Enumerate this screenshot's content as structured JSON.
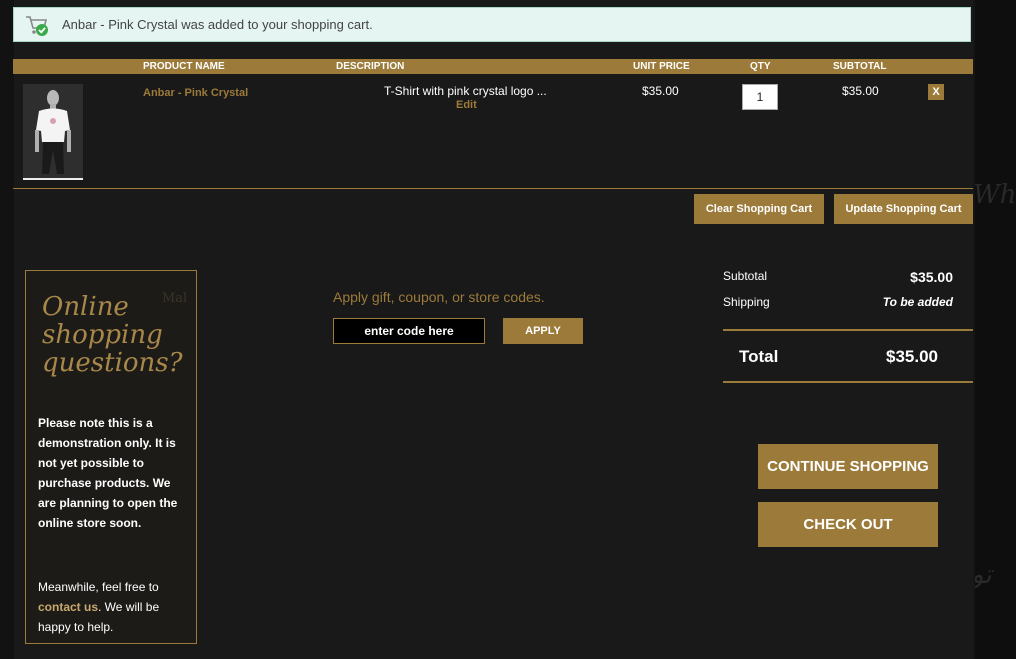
{
  "notice": {
    "message": "Anbar - Pink Crystal was added to your shopping cart.",
    "icon": "cart-check-icon"
  },
  "table": {
    "headers": {
      "product_name": "PRODUCT NAME",
      "description": "DESCRIPTION",
      "unit_price": "UNIT PRICE",
      "qty": "QTY",
      "subtotal": "SUBTOTAL"
    },
    "items": [
      {
        "name": "Anbar - Pink Crystal",
        "description": "T-Shirt with pink crystal logo ...",
        "edit_label": "Edit",
        "unit_price": "$35.00",
        "qty": "1",
        "subtotal": "$35.00",
        "remove_label": "X"
      }
    ]
  },
  "cart_actions": {
    "clear_label": "Clear Shopping Cart",
    "update_label": "Update Shopping Cart"
  },
  "sidebar": {
    "heading": "Online shopping questions?",
    "note": "Please note this is a demonstration only. It is not yet possible to purchase products. We are planning to open the online store soon.",
    "meanwhile": "Meanwhile, feel free to ",
    "contact_link": "contact us",
    "help_text": ". We will be happy to help."
  },
  "coupon": {
    "label": "Apply gift, coupon, or store codes.",
    "placeholder": "enter code here",
    "apply_label": "APPLY"
  },
  "totals": {
    "subtotal_label": "Subtotal",
    "subtotal_value": "$35.00",
    "shipping_label": "Shipping",
    "shipping_value": "To be added",
    "total_label": "Total",
    "total_value": "$35.00"
  },
  "checkout": {
    "continue_label": "CONTINUE SHOPPING",
    "checkout_label": "CHECK OUT"
  },
  "colors": {
    "accent": "#9c7b3a",
    "background": "#191919",
    "notice_bg": "#e5f5f1"
  }
}
